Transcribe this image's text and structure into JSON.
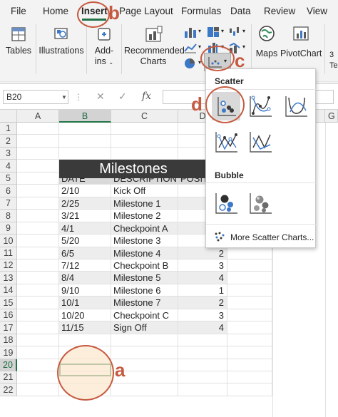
{
  "ribbon": {
    "tabs": [
      "File",
      "Home",
      "Insert",
      "Page Layout",
      "Formulas",
      "Data",
      "Review",
      "View"
    ],
    "active_tab": "Insert",
    "accent_color": "#217346",
    "groups": {
      "tables": "Tables",
      "illustrations": "Illustrations",
      "addins_line1": "Add-",
      "addins_line2": "ins",
      "recommended_line1": "Recommended",
      "recommended_line2": "Charts",
      "maps": "Maps",
      "pivotchart": "PivotChart",
      "partial_line1": "3",
      "partial_line2": "Te"
    }
  },
  "formula_bar": {
    "name_box": "B20",
    "cancel_symbol": "✕",
    "enter_symbol": "✓",
    "fx_symbol": "fx",
    "formula": ""
  },
  "grid": {
    "columns": [
      "A",
      "B",
      "C",
      "D",
      "G"
    ],
    "selected_column": "B",
    "rows": [
      "1",
      "2",
      "3",
      "4",
      "5",
      "6",
      "7",
      "8",
      "9",
      "10",
      "11",
      "12",
      "13",
      "14",
      "15",
      "16",
      "17",
      "18",
      "19",
      "20",
      "21",
      "22"
    ],
    "selected_row": "20"
  },
  "table": {
    "title": "Milestones",
    "headers": [
      "DATE",
      "DESCRIPTION",
      "POSIT"
    ],
    "rows": [
      [
        "2/10",
        "Kick Off",
        ""
      ],
      [
        "2/25",
        "Milestone 1",
        ""
      ],
      [
        "3/21",
        "Milestone 2",
        ""
      ],
      [
        "4/1",
        "Checkpoint A",
        ""
      ],
      [
        "5/20",
        "Milestone 3",
        ""
      ],
      [
        "6/5",
        "Milestone 4",
        "2"
      ],
      [
        "7/12",
        "Checkpoint B",
        "3"
      ],
      [
        "8/4",
        "Milestone 5",
        "4"
      ],
      [
        "9/10",
        "Milestone 6",
        "1"
      ],
      [
        "10/1",
        "Milestone 7",
        "2"
      ],
      [
        "10/20",
        "Checkpoint C",
        "3"
      ],
      [
        "11/15",
        "Sign Off",
        "4"
      ]
    ]
  },
  "dropdown": {
    "scatter_label": "Scatter",
    "bubble_label": "Bubble",
    "more_label": "More Scatter Charts...",
    "scatter_options": [
      "scatter-markers-icon",
      "scatter-smooth-lines-markers-icon",
      "scatter-smooth-lines-icon",
      "scatter-straight-lines-markers-icon",
      "scatter-straight-lines-icon"
    ],
    "bubble_options": [
      "bubble-icon",
      "bubble-3d-icon"
    ]
  },
  "annotations": {
    "a": "a",
    "b": "b",
    "c": "c",
    "d": "d",
    "color": "#c65a40"
  }
}
